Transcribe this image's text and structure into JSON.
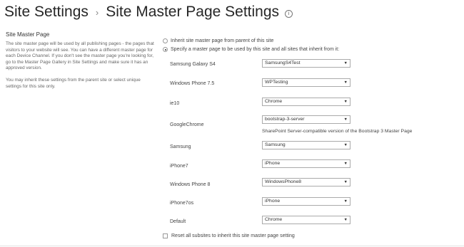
{
  "header": {
    "breadcrumb_parent": "Site Settings",
    "separator": "›",
    "page_title": "Site Master Page Settings",
    "info_glyph": "i"
  },
  "section": {
    "title": "Site Master Page",
    "description": [
      "The site master page will be used by all publishing pages - the pages that visitors to your website will see. You can have a different master page for each Device Channel. If you don't see the master page you're looking for, go to the Master Page Gallery in Site Settings and make sure it has an approved version.",
      "You may inherit these settings from the parent site or select unique settings for this site only."
    ]
  },
  "options": {
    "inherit_label": "Inherit site master page from parent of this site",
    "specify_label": "Specify a master page to be used by this site and all sites that inherit from it:",
    "selected": "specify"
  },
  "devices": [
    {
      "name": "Samsung Galaxy S4",
      "value": "SamsungS4Test"
    },
    {
      "name": "Windows Phone 7.5",
      "value": "WPTesting"
    },
    {
      "name": "ie10",
      "value": "Chrome"
    },
    {
      "name": "GoogleChrome",
      "value": "bootstrap-3-server",
      "hint": "SharePoint Server-compatible version of the Bootstrap 3 Master Page"
    },
    {
      "name": "Samsung",
      "value": "Samsung"
    },
    {
      "name": "iPhone7",
      "value": "iPhone"
    },
    {
      "name": "Windows Phone 8",
      "value": "WindowsPhone8"
    },
    {
      "name": "iPhone7os",
      "value": "iPhone"
    },
    {
      "name": "Default",
      "value": "Chrome"
    }
  ],
  "reset": {
    "label": "Reset all subsites to inherit this site master page setting",
    "checked": false
  },
  "icons": {
    "info": "info-circle-icon",
    "dropdown": "chevron-down-icon"
  }
}
